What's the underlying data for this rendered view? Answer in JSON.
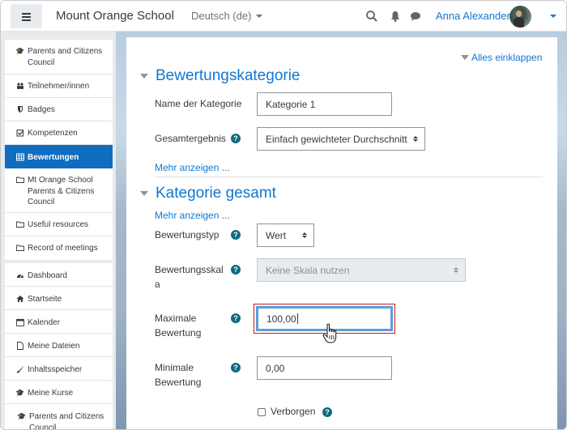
{
  "navbar": {
    "site_name": "Mount Orange School",
    "language": "Deutsch (de)",
    "user_name": "Anna Alexander",
    "icons": [
      "menu-icon",
      "search-icon",
      "bell-icon",
      "chat-icon"
    ]
  },
  "sidebar": {
    "course_items": [
      {
        "label": "Parents and Citizens Council",
        "icon": "graduation-cap-icon"
      },
      {
        "label": "Teilnehmer/innen",
        "icon": "users-icon"
      },
      {
        "label": "Badges",
        "icon": "shield-icon"
      },
      {
        "label": "Kompetenzen",
        "icon": "checkbox-icon"
      },
      {
        "label": "Bewertungen",
        "icon": "table-icon",
        "active": true
      },
      {
        "label": "Mt Orange School Parents & Citizens Council",
        "icon": "folder-icon"
      },
      {
        "label": "Useful resources",
        "icon": "folder-icon"
      },
      {
        "label": "Record of meetings",
        "icon": "folder-icon"
      }
    ],
    "site_items": [
      {
        "label": "Dashboard",
        "icon": "dashboard-icon"
      },
      {
        "label": "Startseite",
        "icon": "home-icon"
      },
      {
        "label": "Kalender",
        "icon": "calendar-icon"
      },
      {
        "label": "Meine Dateien",
        "icon": "file-icon"
      },
      {
        "label": "Inhaltsspeicher",
        "icon": "brush-icon"
      },
      {
        "label": "Meine Kurse",
        "icon": "graduation-cap-icon"
      },
      {
        "label": "Parents and Citizens Council",
        "icon": "graduation-cap-icon"
      }
    ]
  },
  "main": {
    "collapse_all": "Alles einklappen",
    "section1": {
      "title": "Bewertungskategorie",
      "category_name_label": "Name der Kategorie",
      "category_name_value": "Kategorie 1",
      "aggregation_label": "Gesamtergebnis",
      "aggregation_value": "Einfach gewichteter Durchschnitt",
      "show_more": "Mehr anzeigen ..."
    },
    "section2": {
      "title": "Kategorie gesamt",
      "show_more": "Mehr anzeigen ...",
      "grade_type_label": "Bewertungstyp",
      "grade_type_value": "Wert",
      "scale_label_line1": "Bewertungsskal",
      "scale_label_line2": "a",
      "scale_value": "Keine Skala nutzen",
      "max_grade_label_line1": "Maximale",
      "max_grade_label_line2": "Bewertung",
      "max_grade_value": "100,00",
      "min_grade_label_line1": "Minimale",
      "min_grade_label_line2": "Bewertung",
      "min_grade_value": "0,00",
      "hidden_label": "Verborgen",
      "hidden_checked": false
    },
    "help_glyph": "?"
  },
  "colors": {
    "brand_blue": "#0f6cbf",
    "link_blue": "#1177d1",
    "help_teal": "#0f6c80",
    "focus_ring": "#5b9fdb",
    "error_border": "#c41e1e"
  }
}
